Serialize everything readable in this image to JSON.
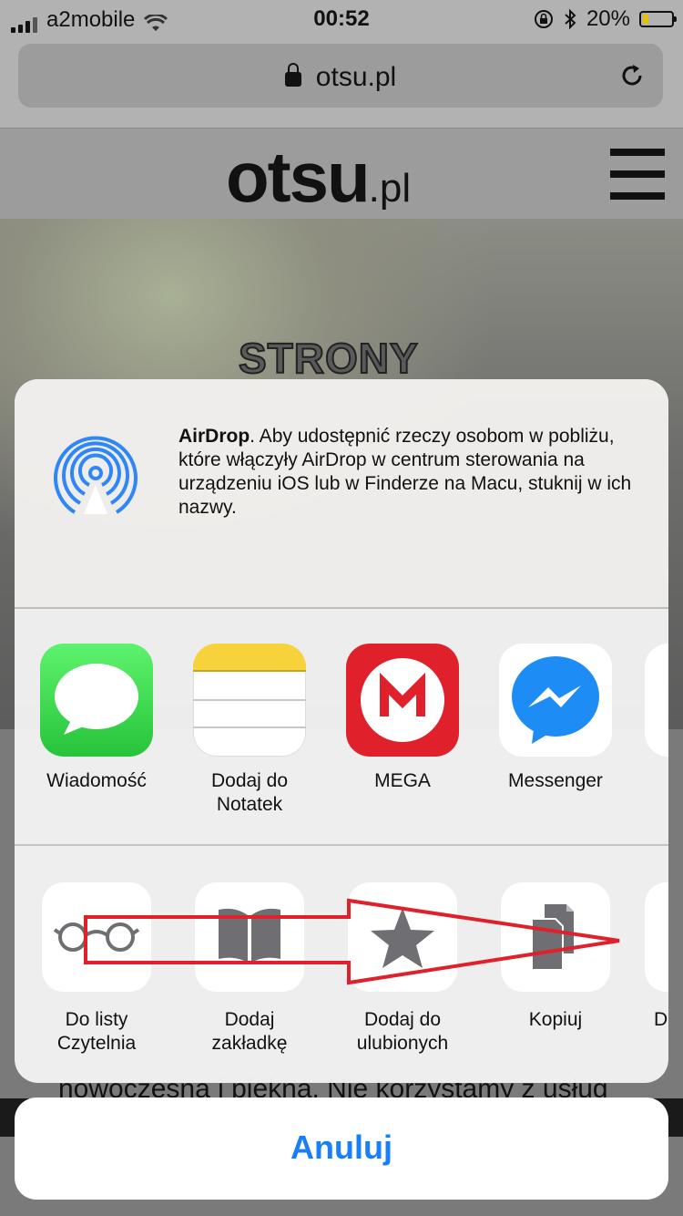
{
  "status_bar": {
    "carrier": "a2mobile",
    "time": "00:52",
    "battery_percent": "20%",
    "battery_level": 0.2,
    "battery_color": "#e6c100"
  },
  "browser": {
    "url": "otsu.pl",
    "lock_icon": "lock-icon",
    "reload_icon": "reload-icon"
  },
  "page": {
    "logo_main": "otsu",
    "logo_suffix": ".pl",
    "hero_title": "STRONY",
    "body_text": "nowoczesna i piękna. Nie korzystamy z usług"
  },
  "share_sheet": {
    "airdrop": {
      "title": "AirDrop",
      "description": ". Aby udostępnić rzeczy osobom w pobliżu, które włączyły AirDrop w centrum sterowania na urządzeniu iOS lub w Finderze na Macu, stuknij w ich nazwy.",
      "icon": "airdrop-icon",
      "accent": "#2f86f6"
    },
    "apps": [
      {
        "label": "Wiadomość",
        "icon": "messages-icon",
        "color": "#3fd651"
      },
      {
        "label": "Dodaj do Notatek",
        "icon": "notes-icon",
        "color": "#f8d23a"
      },
      {
        "label": "MEGA",
        "icon": "mega-icon",
        "color": "#e0202a"
      },
      {
        "label": "Messenger",
        "icon": "messenger-icon",
        "color": "#1e8cf5"
      }
    ],
    "actions": [
      {
        "label": "Do listy Czytelnia",
        "icon": "reading-list-icon"
      },
      {
        "label": "Dodaj zakładkę",
        "icon": "bookmark-icon"
      },
      {
        "label": "Dodaj do ulubionych",
        "icon": "favorites-star-icon"
      },
      {
        "label": "Kopiuj",
        "icon": "copy-icon"
      },
      {
        "label": "D",
        "icon": "more-action-icon"
      }
    ],
    "annotation_color": "#e0202a",
    "cancel_label": "Anuluj",
    "cancel_color": "#1a7ef7"
  }
}
